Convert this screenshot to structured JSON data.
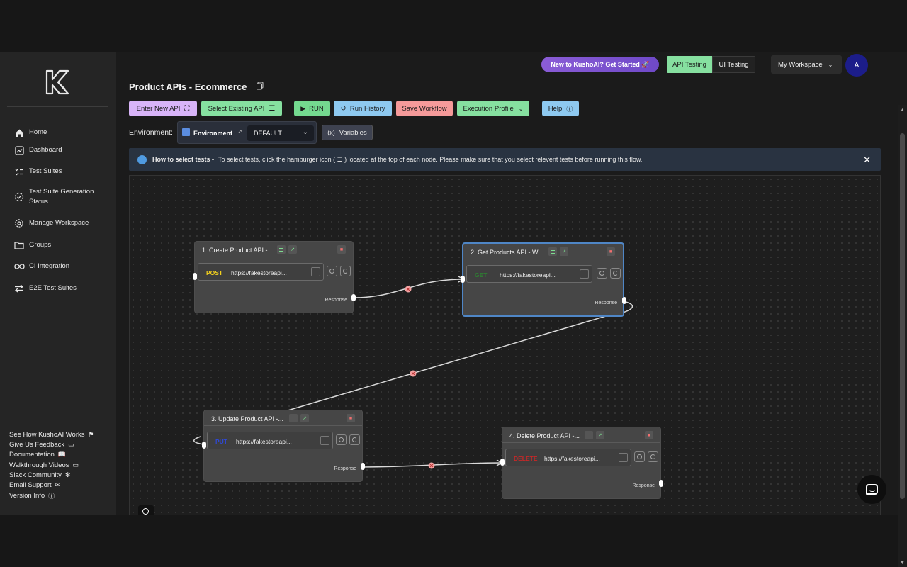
{
  "sidebar": {
    "items": [
      {
        "label": "Home",
        "icon": "home-icon"
      },
      {
        "label": "Dashboard",
        "icon": "dashboard-icon"
      },
      {
        "label": "Test Suites",
        "icon": "checklist-icon"
      },
      {
        "label": "Test Suite Generation Status",
        "line1": "Test Suite Generation",
        "line2": "Status",
        "icon": "status-icon"
      },
      {
        "label": "Manage Workspace",
        "icon": "gear-icon"
      },
      {
        "label": "Groups",
        "icon": "folder-icon"
      },
      {
        "label": "CI Integration",
        "icon": "infinity-icon"
      },
      {
        "label": "E2E Test Suites",
        "icon": "swap-icon"
      }
    ],
    "footer": [
      {
        "label": "See How KushoAI Works",
        "icon": "flag-icon"
      },
      {
        "label": "Give Us Feedback",
        "icon": "feedback-icon"
      },
      {
        "label": "Documentation",
        "icon": "book-icon"
      },
      {
        "label": "Walkthrough Videos",
        "icon": "video-icon"
      },
      {
        "label": "Slack Community",
        "icon": "slack-icon"
      },
      {
        "label": "Email Support",
        "icon": "mail-icon"
      },
      {
        "label": "Version Info",
        "icon": "info-icon"
      }
    ]
  },
  "header": {
    "new_pill": "New to KushoAI? Get Started 🚀",
    "api_testing": "API Testing",
    "ui_testing": "UI Testing",
    "workspace": "My Workspace",
    "avatar": "A"
  },
  "page": {
    "title": "Product APIs - Ecommerce"
  },
  "toolbar": {
    "enter_new_api": "Enter New API",
    "select_existing_api": "Select Existing API",
    "run": "RUN",
    "run_history": "Run History",
    "save_workflow": "Save Workflow",
    "execution_profile": "Execution Profile",
    "help": "Help"
  },
  "environment": {
    "label": "Environment:",
    "box_label": "Environment",
    "selected": "DEFAULT",
    "variables": "Variables"
  },
  "info": {
    "bold": "How to select tests -",
    "text": "To select tests, click the hamburger icon ( ☰ ) located at the top of each node. Please make sure that you select relevent tests before running this flow."
  },
  "nodes": [
    {
      "title": "1. Create Product API -...",
      "method": "POST",
      "method_color": "#f2d01e",
      "url": "https://fakestoreapi...",
      "response": "Response"
    },
    {
      "title": "2. Get Products API - W...",
      "method": "GET",
      "method_color": "#2e7d32",
      "url": "https://fakestoreapi...",
      "response": "Response"
    },
    {
      "title": "3. Update Product API -...",
      "method": "PUT",
      "method_color": "#2f49d6",
      "url": "https://fakestoreapi...",
      "response": "Response"
    },
    {
      "title": "4. Delete Product API -...",
      "method": "DELETE",
      "method_color": "#c62828",
      "url": "https://fakestoreapi...",
      "response": "Response"
    }
  ],
  "colors": {
    "enter_new_api": "#d8b4f8",
    "select_existing_api": "#86e0a0",
    "run": "#74d98f",
    "run_history": "#8ec9f0",
    "save_workflow": "#f59a9a",
    "execution_profile": "#86e0a0",
    "help": "#8ec9f0",
    "api_testing_active": "#86e0a0"
  }
}
